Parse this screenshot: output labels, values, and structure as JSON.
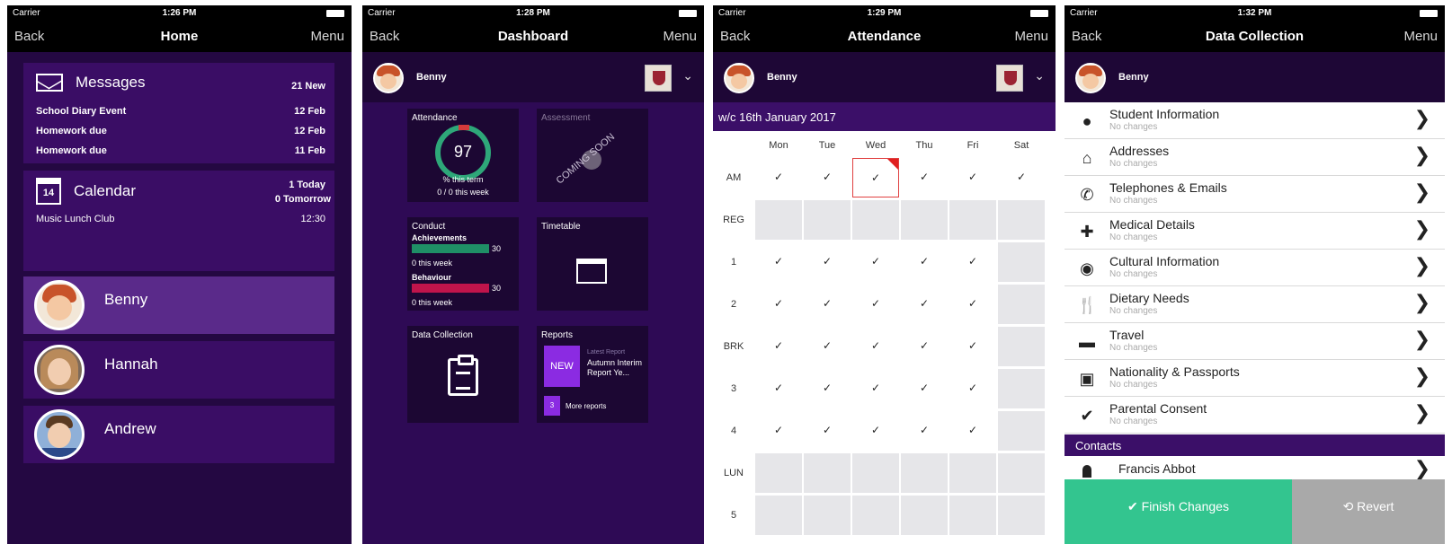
{
  "status": {
    "carrier": "Carrier",
    "times": [
      "1:26 PM",
      "1:28 PM",
      "1:29 PM",
      "1:32 PM"
    ]
  },
  "nav": {
    "back": "Back",
    "menu": "Menu",
    "titles": [
      "Home",
      "Dashboard",
      "Attendance",
      "Data Collection"
    ]
  },
  "home": {
    "messages": {
      "title": "Messages",
      "count": "21 New",
      "items": [
        {
          "title": "School Diary Event",
          "date": "12 Feb"
        },
        {
          "title": "Homework due",
          "date": "12 Feb"
        },
        {
          "title": "Homework due",
          "date": "11 Feb"
        }
      ]
    },
    "calendar": {
      "title": "Calendar",
      "icon_day": "14",
      "today": "1 Today",
      "tomorrow": "0 Tomorrow",
      "event": "Music Lunch Club",
      "event_time": "12:30"
    },
    "children": [
      "Benny",
      "Hannah",
      "Andrew"
    ]
  },
  "user": {
    "name": "Benny"
  },
  "dashboard": {
    "attendance": {
      "title": "Attendance",
      "value": "97",
      "term_label": "% this term",
      "week_label": "0 / 0 this week"
    },
    "assessment": {
      "title": "Assessment",
      "overlay": "COMING SOON"
    },
    "conduct": {
      "title": "Conduct",
      "achievements": {
        "label": "Achievements",
        "value": "30",
        "sub": "0 this week",
        "color": "#1f8f66"
      },
      "behaviour": {
        "label": "Behaviour",
        "value": "30",
        "sub": "0 this week",
        "color": "#c0144b"
      }
    },
    "timetable": {
      "title": "Timetable"
    },
    "data_collection": {
      "title": "Data Collection"
    },
    "reports": {
      "title": "Reports",
      "badge": "NEW",
      "latest_label": "Latest Report",
      "latest_title": "Autumn Interim Report Ye...",
      "more_count": "3",
      "more_label": "More reports"
    }
  },
  "attendance": {
    "week": "w/c 16th January 2017",
    "days": [
      "Mon",
      "Tue",
      "Wed",
      "Thu",
      "Fri",
      "Sat"
    ],
    "rows": [
      {
        "label": "AM",
        "cells": [
          "check",
          "check",
          "highlight",
          "check",
          "check",
          "check"
        ]
      },
      {
        "label": "REG",
        "cells": [
          "grey",
          "grey",
          "grey",
          "grey",
          "grey",
          "grey"
        ]
      },
      {
        "label": "1",
        "cells": [
          "check",
          "check",
          "check",
          "check",
          "check",
          "grey"
        ]
      },
      {
        "label": "2",
        "cells": [
          "check",
          "check",
          "check",
          "check",
          "check",
          "grey"
        ]
      },
      {
        "label": "BRK",
        "cells": [
          "check",
          "check",
          "check",
          "check",
          "check",
          "grey"
        ]
      },
      {
        "label": "3",
        "cells": [
          "check",
          "check",
          "check",
          "check",
          "check",
          "grey"
        ]
      },
      {
        "label": "4",
        "cells": [
          "check",
          "check",
          "check",
          "check",
          "check",
          "grey"
        ]
      },
      {
        "label": "LUN",
        "cells": [
          "grey",
          "grey",
          "grey",
          "grey",
          "grey",
          "grey"
        ]
      },
      {
        "label": "5",
        "cells": [
          "grey",
          "grey",
          "grey",
          "grey",
          "grey",
          "grey"
        ]
      }
    ],
    "check_mark": "✓"
  },
  "data_collection": {
    "items": [
      {
        "label": "Student Information",
        "sub": "No changes",
        "icon": "person-icon"
      },
      {
        "label": "Addresses",
        "sub": "No changes",
        "icon": "house-icon"
      },
      {
        "label": "Telephones & Emails",
        "sub": "No changes",
        "icon": "phone-icon"
      },
      {
        "label": "Medical Details",
        "sub": "No changes",
        "icon": "medical-kit-icon"
      },
      {
        "label": "Cultural Information",
        "sub": "No changes",
        "icon": "globe-icon"
      },
      {
        "label": "Dietary Needs",
        "sub": "No changes",
        "icon": "cutlery-icon"
      },
      {
        "label": "Travel",
        "sub": "No changes",
        "icon": "car-icon"
      },
      {
        "label": "Nationality & Passports",
        "sub": "No changes",
        "icon": "passport-icon"
      },
      {
        "label": "Parental Consent",
        "sub": "No changes",
        "icon": "check-icon"
      }
    ],
    "contacts_header": "Contacts",
    "contact": "Francis Abbot",
    "finish": "✔ Finish Changes",
    "revert": "⟲ Revert"
  }
}
